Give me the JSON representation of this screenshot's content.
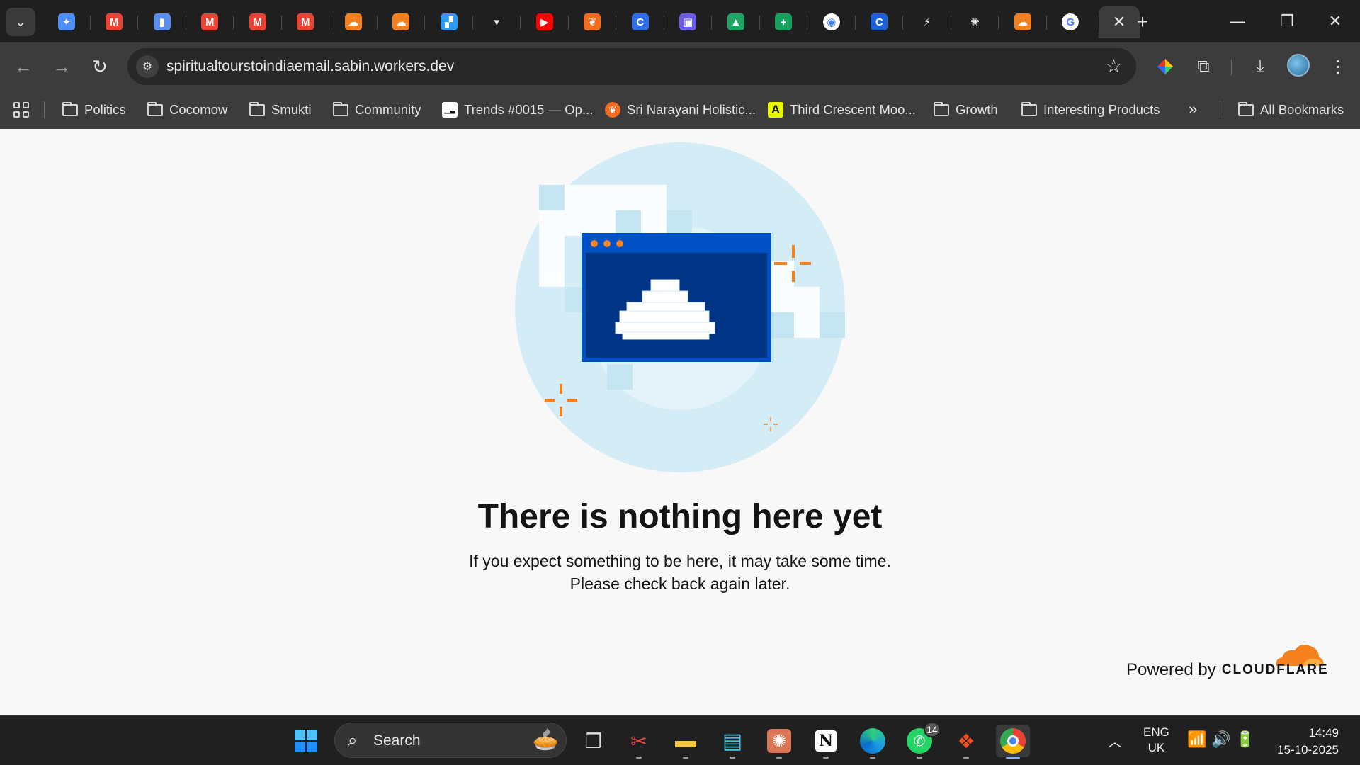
{
  "browser": {
    "tabs": [
      {
        "name": "Gemini",
        "icon": "gemini-icon",
        "color": "#4f8df7",
        "glyph": "✦"
      },
      {
        "name": "Gmail",
        "icon": "gmail-icon",
        "color": "#ea4335",
        "glyph": "M"
      },
      {
        "name": "Analytics",
        "icon": "bar-chart-icon",
        "color": "#5b8def",
        "glyph": "▮"
      },
      {
        "name": "Gmail",
        "icon": "gmail-icon",
        "color": "#ea4335",
        "glyph": "M"
      },
      {
        "name": "Gmail",
        "icon": "gmail-icon",
        "color": "#ea4335",
        "glyph": "M"
      },
      {
        "name": "Gmail",
        "icon": "gmail-icon",
        "color": "#ea4335",
        "glyph": "M"
      },
      {
        "name": "Cloudflare",
        "icon": "cloudflare-icon",
        "color": "#f38020",
        "glyph": "☁"
      },
      {
        "name": "Cloudflare",
        "icon": "cloudflare-icon",
        "color": "#f38020",
        "glyph": "☁"
      },
      {
        "name": "Blocks",
        "icon": "blocks-icon",
        "color": "#2b9af3",
        "glyph": "▞"
      },
      {
        "name": "Dark",
        "icon": "dark-favicon-icon",
        "color": "#2a2a2a",
        "glyph": "▾"
      },
      {
        "name": "YouTube",
        "icon": "youtube-icon",
        "color": "#ff0000",
        "glyph": "▶"
      },
      {
        "name": "Sri Narayani",
        "icon": "orange-leaf-icon",
        "color": "#f26b21",
        "glyph": "❦"
      },
      {
        "name": "Copilot",
        "icon": "c-circle-icon",
        "color": "#2f6ee8",
        "glyph": "C"
      },
      {
        "name": "Image",
        "icon": "image-icon",
        "color": "#6b5be6",
        "glyph": "▣"
      },
      {
        "name": "Drive",
        "icon": "google-drive-icon",
        "color": "#1fa463",
        "glyph": "▲"
      },
      {
        "name": "Sheets",
        "icon": "plus-sheet-icon",
        "color": "#18a05e",
        "glyph": "+"
      },
      {
        "name": "Audio",
        "icon": "audio-icon",
        "color": "#ffffff",
        "glyph": "◉"
      },
      {
        "name": "Copilot",
        "icon": "c-circle-icon",
        "color": "#1e5fdc",
        "glyph": "C"
      },
      {
        "name": "Bolt",
        "icon": "bolt-icon",
        "color": "#1f1f1f",
        "glyph": "⚡"
      },
      {
        "name": "ChatGPT",
        "icon": "openai-icon",
        "color": "#1f1f1f",
        "glyph": "✺"
      },
      {
        "name": "Cloudflare",
        "icon": "cloudflare-icon",
        "color": "#f38020",
        "glyph": "☁"
      },
      {
        "name": "Google",
        "icon": "google-icon",
        "color": "#ffffff",
        "glyph": "G"
      }
    ],
    "url": "spiritualtourstoindiaemail.sabin.workers.dev",
    "bookmarks": [
      {
        "label": "Politics",
        "type": "folder"
      },
      {
        "label": "Cocomow",
        "type": "folder"
      },
      {
        "label": "Smukti",
        "type": "folder"
      },
      {
        "label": "Community",
        "type": "folder"
      },
      {
        "label": "Trends #0015 — Op...",
        "type": "site",
        "icon": "trends-icon"
      },
      {
        "label": "Sri Narayani Holistic...",
        "type": "site",
        "icon": "orange-leaf-icon"
      },
      {
        "label": "Third Crescent Moo...",
        "type": "site",
        "icon": "letter-a-icon"
      },
      {
        "label": "Growth",
        "type": "folder"
      },
      {
        "label": "Interesting Products",
        "type": "folder"
      }
    ],
    "more_bookmarks": "»",
    "all_bookmarks": "All Bookmarks"
  },
  "page": {
    "headline": "There is nothing here yet",
    "sub_line1": "If you expect something to be here, it may take some time.",
    "sub_line2": "Please check back again later.",
    "powered_by": "Powered by",
    "cloudflare_word": "CLOUDFLARE",
    "accent_orange": "#f6821f",
    "accent_blue": "#0051c3"
  },
  "taskbar": {
    "search_label": "Search",
    "lang_line1": "ENG",
    "lang_line2": "UK",
    "time": "14:49",
    "date": "15-10-2025",
    "whatsapp_badge": "14"
  }
}
